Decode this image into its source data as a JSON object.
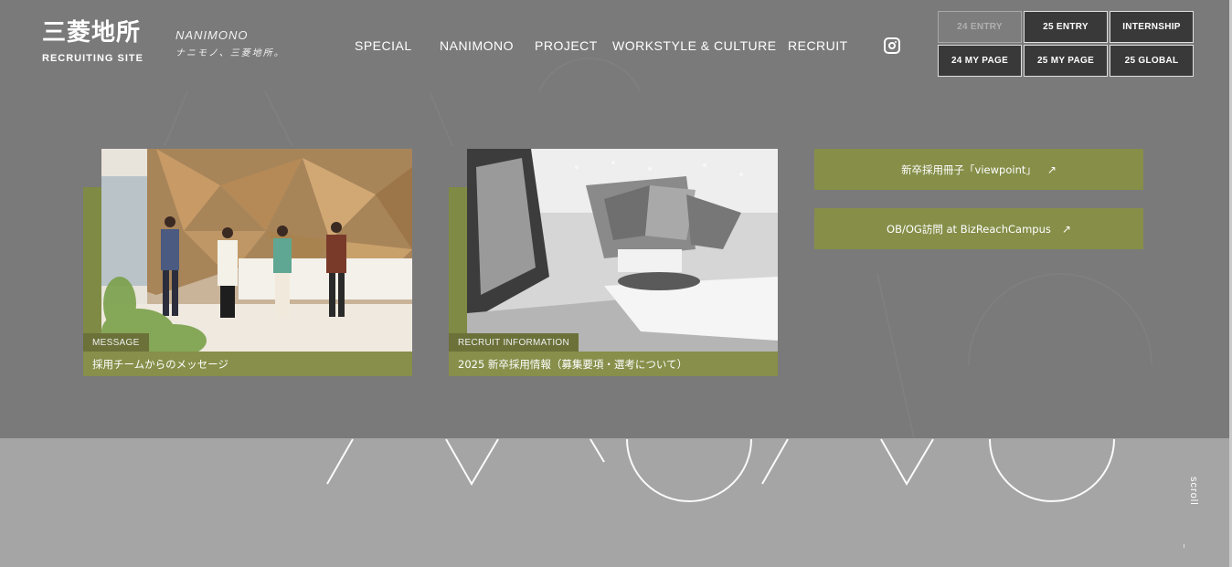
{
  "header": {
    "logo_kanji": "三菱地所",
    "logo_sub": "RECRUITING SITE",
    "tagline_en": "NANIMONO",
    "tagline_ja": "ナニモノ、三菱地所。"
  },
  "nav": {
    "items": [
      {
        "label": "SPECIAL"
      },
      {
        "label": "NANIMONO"
      },
      {
        "label": "PROJECT"
      },
      {
        "label": "WORKSTYLE & CULTURE"
      },
      {
        "label": "RECRUIT"
      }
    ],
    "instagram_icon": "instagram-icon"
  },
  "header_buttons": [
    {
      "label": "24 ENTRY",
      "disabled": true
    },
    {
      "label": "25 ENTRY",
      "disabled": false
    },
    {
      "label": "INTERNSHIP",
      "disabled": false
    },
    {
      "label": "24 MY PAGE",
      "disabled": false
    },
    {
      "label": "25 MY PAGE",
      "disabled": false
    },
    {
      "label": "25 GLOBAL",
      "disabled": false
    }
  ],
  "cards": [
    {
      "tag": "MESSAGE",
      "caption": "採用チームからのメッセージ"
    },
    {
      "tag": "RECRUIT INFORMATION",
      "caption": "2025 新卒採用情報（募集要項・選考について）"
    }
  ],
  "side_buttons": [
    {
      "label": "新卒採用冊子「viewpoint」",
      "icon": "external-link-icon",
      "arrow": "↗"
    },
    {
      "label": "OB/OG訪問 at BizReachCampus",
      "icon": "external-link-icon",
      "arrow": "↗"
    }
  ],
  "scroll_label": "scroll",
  "colors": {
    "overlay": "#7a7a7a",
    "olive_accent": "#868e48",
    "olive_dark": "#6b7138",
    "button_dark": "#393939"
  }
}
